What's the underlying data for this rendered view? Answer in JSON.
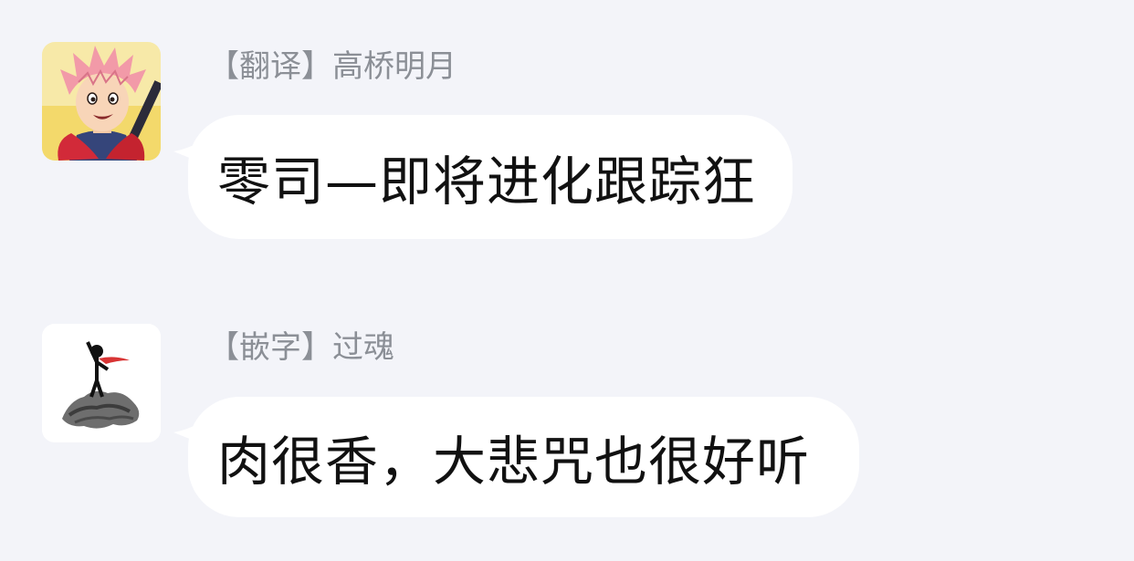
{
  "messages": [
    {
      "sender": "【翻译】高桥明月",
      "text": "零司—即将进化跟踪狂",
      "avatar": "anime-boy-pink-hair-avatar"
    },
    {
      "sender": "【嵌字】过魂",
      "text": "肉很香，大悲咒也很好听",
      "avatar": "stickman-silhouette-avatar"
    }
  ],
  "colors": {
    "background": "#f3f4f9",
    "bubble": "#ffffff",
    "sender_text": "#8b8f96",
    "message_text": "#111111"
  }
}
